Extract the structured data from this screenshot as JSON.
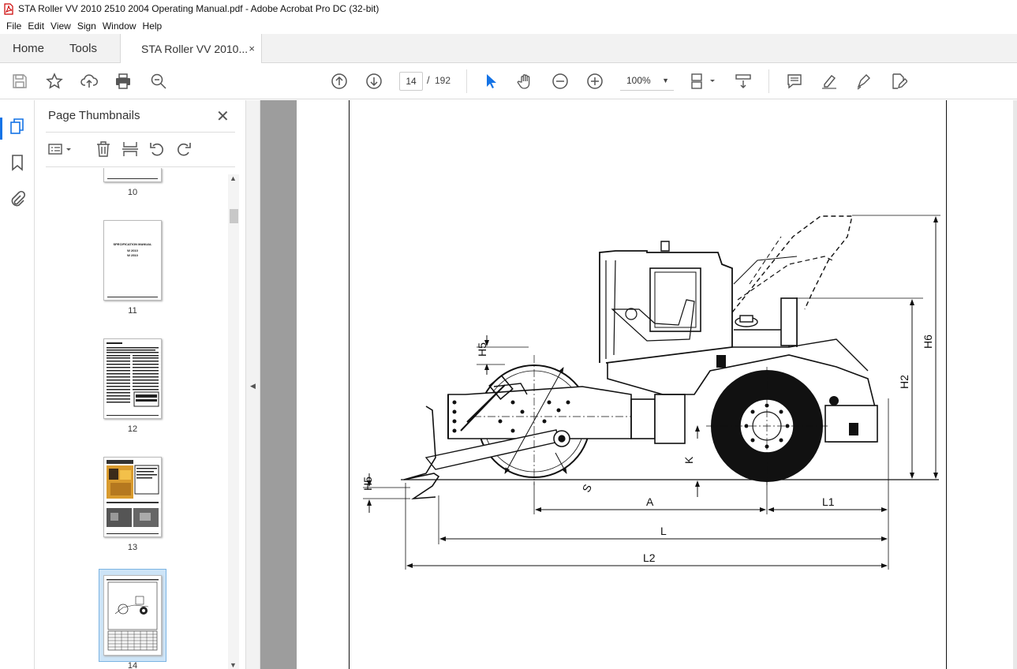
{
  "window": {
    "title": "STA Roller VV 2010 2510 2004 Operating Manual.pdf - Adobe Acrobat Pro DC (32-bit)"
  },
  "menu": [
    "File",
    "Edit",
    "View",
    "Sign",
    "Window",
    "Help"
  ],
  "tabs": {
    "home": "Home",
    "tools": "Tools",
    "document": "STA Roller VV 2010...",
    "close": "×"
  },
  "toolbar": {
    "page_current": "14",
    "page_separator": "/",
    "page_total": "192",
    "zoom": "100%"
  },
  "panel": {
    "title": "Page Thumbnails",
    "close": "✕",
    "thumbnails": [
      {
        "label": "10"
      },
      {
        "label": "11",
        "heading": "SPECIFICATION MANUAL",
        "sub1": "W 2010",
        "sub2": "W 2510"
      },
      {
        "label": "12"
      },
      {
        "label": "13"
      },
      {
        "label": "14",
        "selected": true
      }
    ]
  },
  "drawing": {
    "labels": {
      "h5_top": "H5",
      "h5_bottom": "H5",
      "h6": "H6",
      "h2": "H2",
      "k": "K",
      "s": "S",
      "a": "A",
      "l1": "L1",
      "l": "L",
      "l2": "L2"
    }
  }
}
